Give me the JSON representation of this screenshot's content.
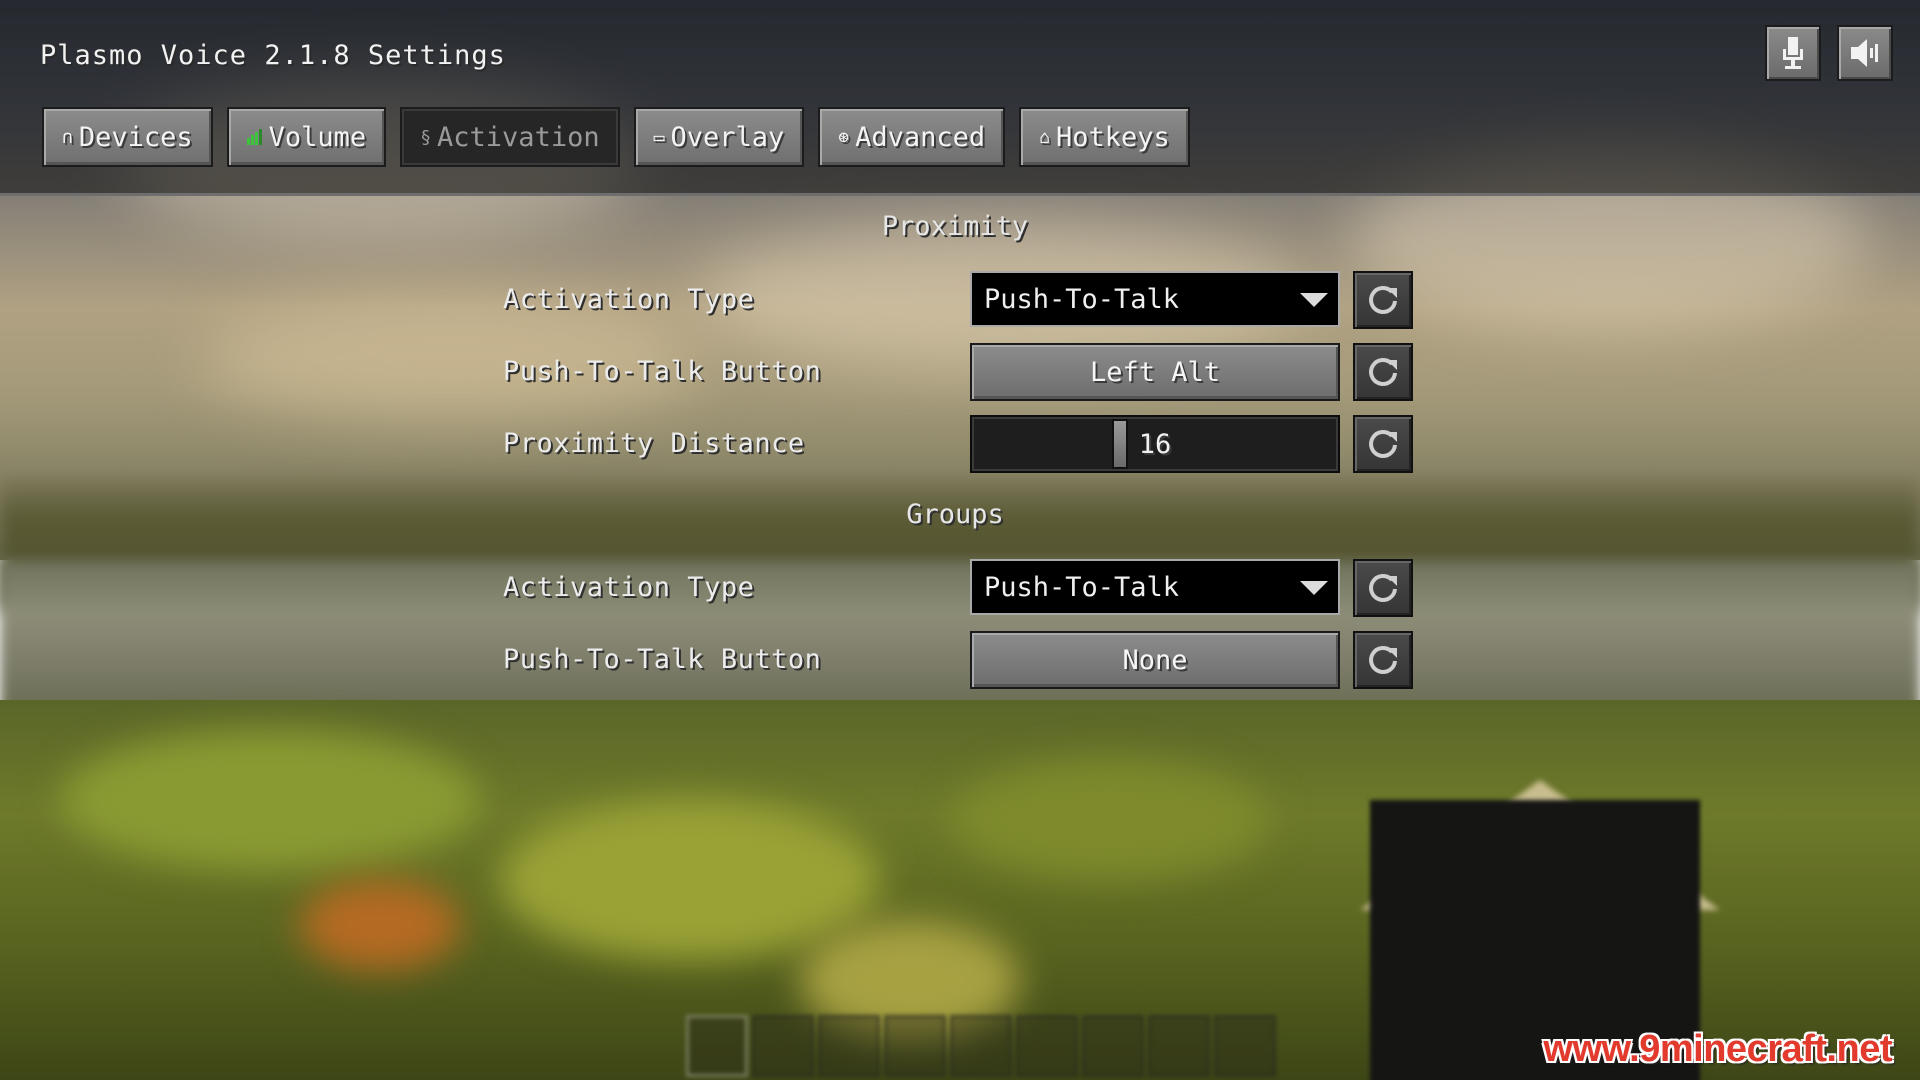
{
  "window": {
    "title": "Plasmo Voice 2.1.8 Settings"
  },
  "header_icons": [
    {
      "name": "microphone-icon"
    },
    {
      "name": "speaker-icon"
    }
  ],
  "tabs": [
    {
      "label": "Devices",
      "icon": "headphones-icon",
      "active": false
    },
    {
      "label": "Volume",
      "icon": "volume-bars-icon",
      "active": false
    },
    {
      "label": "Activation",
      "icon": "activation-icon",
      "active": true
    },
    {
      "label": "Overlay",
      "icon": "monitor-icon",
      "active": false
    },
    {
      "label": "Advanced",
      "icon": "gear-icon",
      "active": false
    },
    {
      "label": "Hotkeys",
      "icon": "keyboard-icon",
      "active": false
    }
  ],
  "proximity": {
    "heading": "Proximity",
    "activation_type_label": "Activation Type",
    "activation_type_value": "Push-To-Talk",
    "ptt_button_label": "Push-To-Talk Button",
    "ptt_button_value": "Left Alt",
    "distance_label": "Proximity Distance",
    "distance_value": "16",
    "distance_fraction": 0.4
  },
  "groups": {
    "heading": "Groups",
    "activation_type_label": "Activation Type",
    "activation_type_value": "Push-To-Talk",
    "ptt_button_label": "Push-To-Talk Button",
    "ptt_button_value": "None"
  },
  "hotbar": {
    "slot_count": 9,
    "selected_slot": 1
  },
  "watermark": "www.9minecraft.net",
  "colors": {
    "active_tab_bg": "#262626",
    "volume_icon": "#3cc43c",
    "watermark": "#e23b2e"
  }
}
